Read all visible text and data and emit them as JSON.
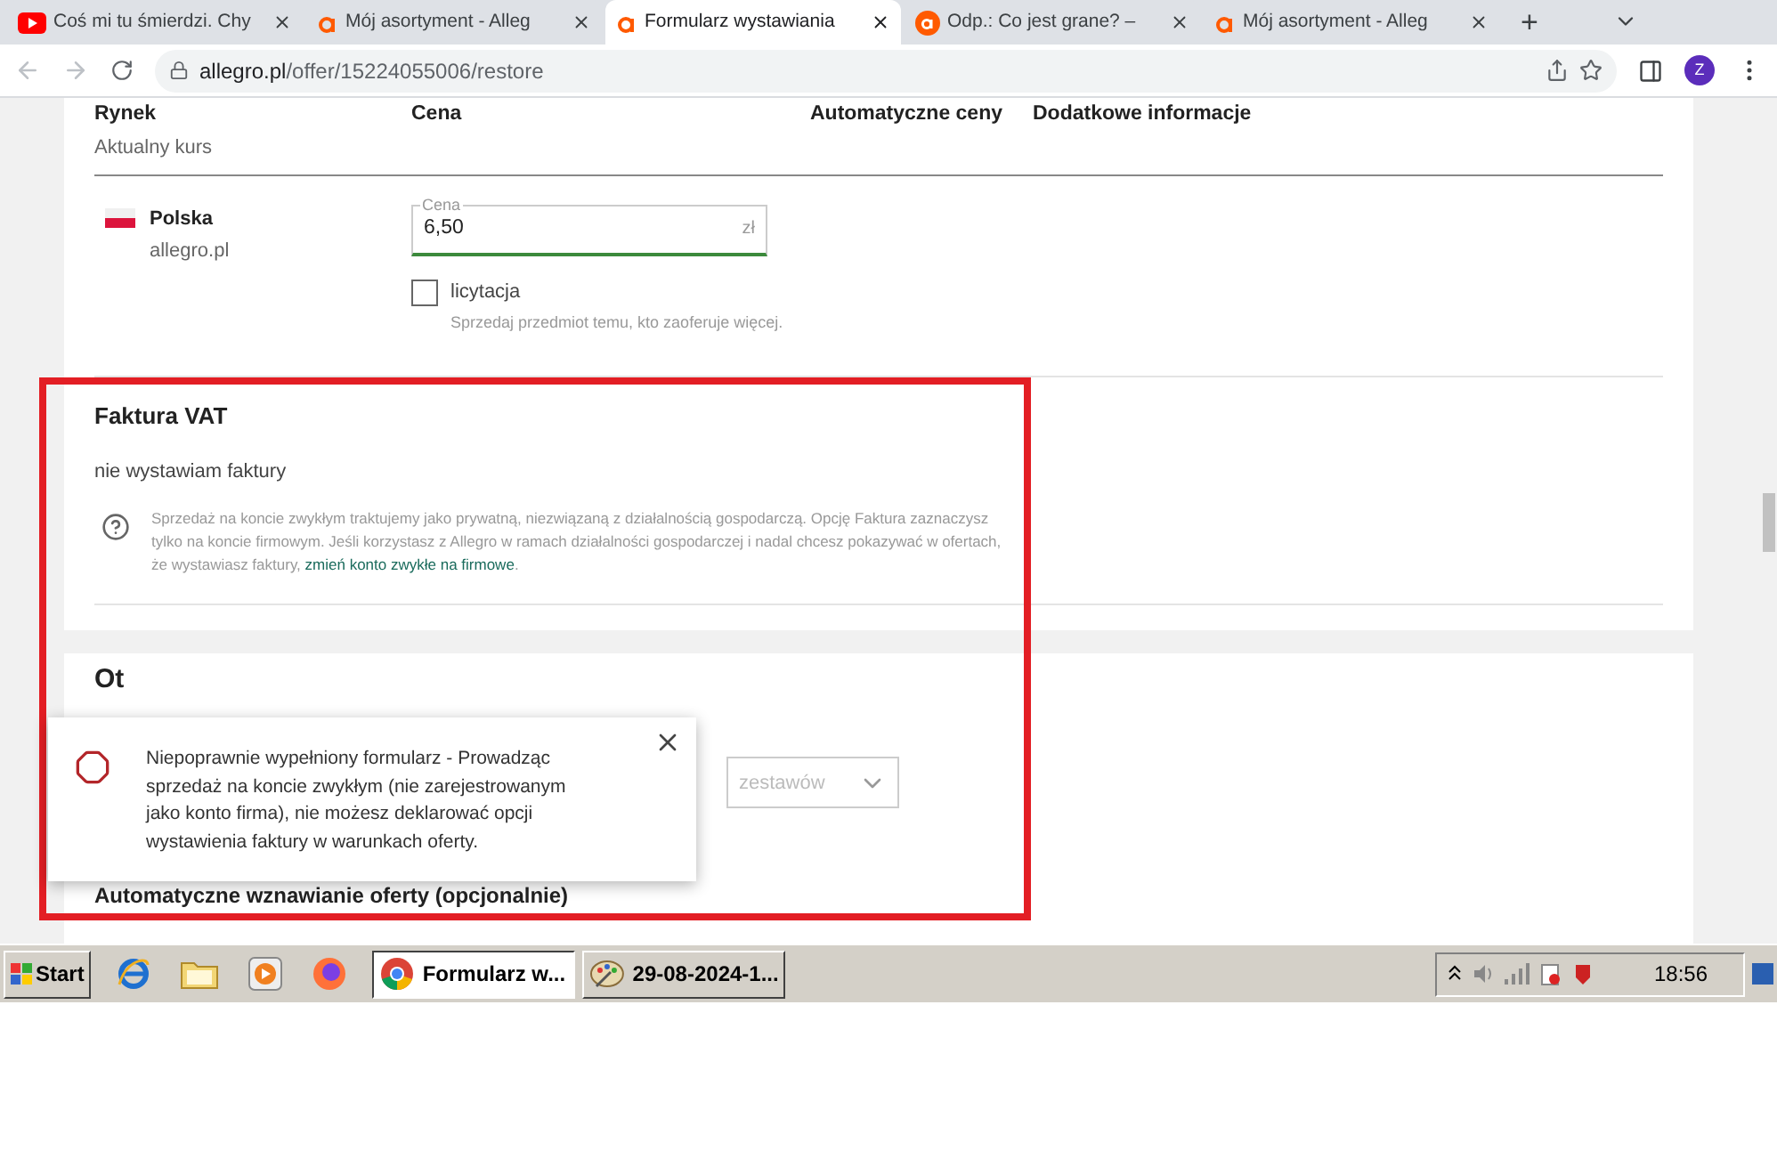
{
  "browser": {
    "tabs": [
      {
        "title": "Coś mi tu śmierdzi. Chy",
        "kind": "video",
        "selected": false
      },
      {
        "title": "Mój asortyment - Alleg",
        "kind": "shop",
        "selected": false
      },
      {
        "title": "Formularz wystawiania",
        "kind": "shop",
        "selected": true
      },
      {
        "title": "Odp.: Co jest grane? –",
        "kind": "forum",
        "selected": false
      },
      {
        "title": "Mój asortyment - Alleg",
        "kind": "shop",
        "selected": false
      }
    ],
    "new_tab": "+",
    "url_host": "allegro.pl",
    "url_path": "/offer/15224055006/restore",
    "profile": "Z"
  },
  "market_table": {
    "columns": [
      "Rynek",
      "Cena",
      "Automatyczne ceny",
      "Dodatkowe informacje"
    ],
    "subheader": "Aktualny kurs",
    "row": {
      "country": "Polska",
      "site": "allegro.pl",
      "price_label": "Cena",
      "price_value": "6,50",
      "unit": "zł",
      "auction_label": "licytacja",
      "auction_checked": false,
      "auction_hint": "Sprzedaj przedmiot temu, kto zaoferuje więcej."
    }
  },
  "invoice_section": {
    "title": "Faktura VAT",
    "value": "nie wystawiam faktury",
    "info": "Sprzedaż na koncie zwykłym traktujemy jako prywatną, niezwiązaną z działalnością gospodarczą. Opcję Faktura zaznaczysz tylko na koncie firmowym. Jeśli korzystasz z Allegro w ramach działalności gospodarczej i nadal chcesz pokazywać w ofertach, że wystawiasz faktury,",
    "info_link": "zmień konto zwykłe na firmowe",
    "info_end": "."
  },
  "next_section": {
    "title": "Ot",
    "dropdown": "zestawów",
    "subtitle": "Automatyczne wznawianie oferty (opcjonalnie)"
  },
  "toast": {
    "message": "Niepoprawnie wypełniony formularz - Prowadząc sprzedaż na koncie zwykłym (nie zarejestrowanym jako konto firma), nie możesz deklarować opcji wystawienia faktury w warunkach oferty."
  },
  "taskbar": {
    "start": "Start",
    "tasks": [
      {
        "label": "Formularz w...",
        "kind": "browser",
        "selected": true
      },
      {
        "label": "29-08-2024-1...",
        "kind": "paint",
        "selected": false
      }
    ],
    "time": "18:56"
  }
}
